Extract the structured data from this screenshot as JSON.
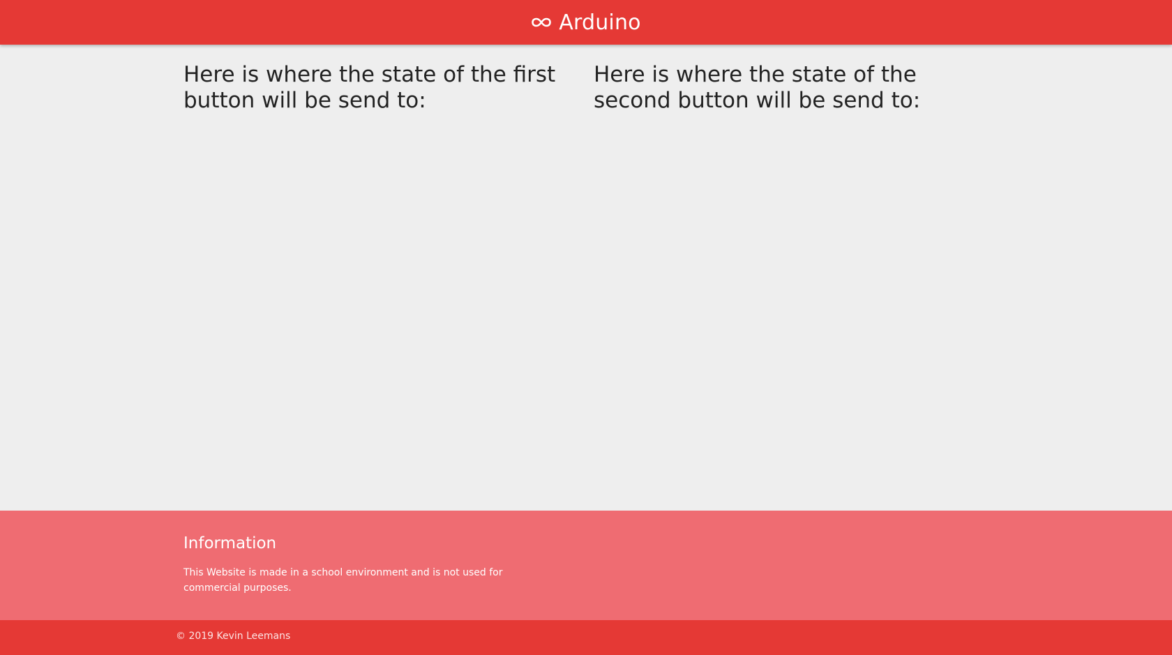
{
  "header": {
    "brand": {
      "icon": "infinity-icon",
      "label": "Arduino"
    }
  },
  "main": {
    "first_button_text": "Here is where the state of the first button will be send to:",
    "second_button_text": "Here is where the state of the second button will be send to:"
  },
  "footer": {
    "title": "Information",
    "text": "This Website is made in a school environment and is not used for commercial purposes.",
    "copyright": "© 2019 Kevin Leemans"
  },
  "colors": {
    "primary": "#e53935",
    "footer": "#ef6c72",
    "background": "#eeeeee",
    "text": "#222222"
  }
}
